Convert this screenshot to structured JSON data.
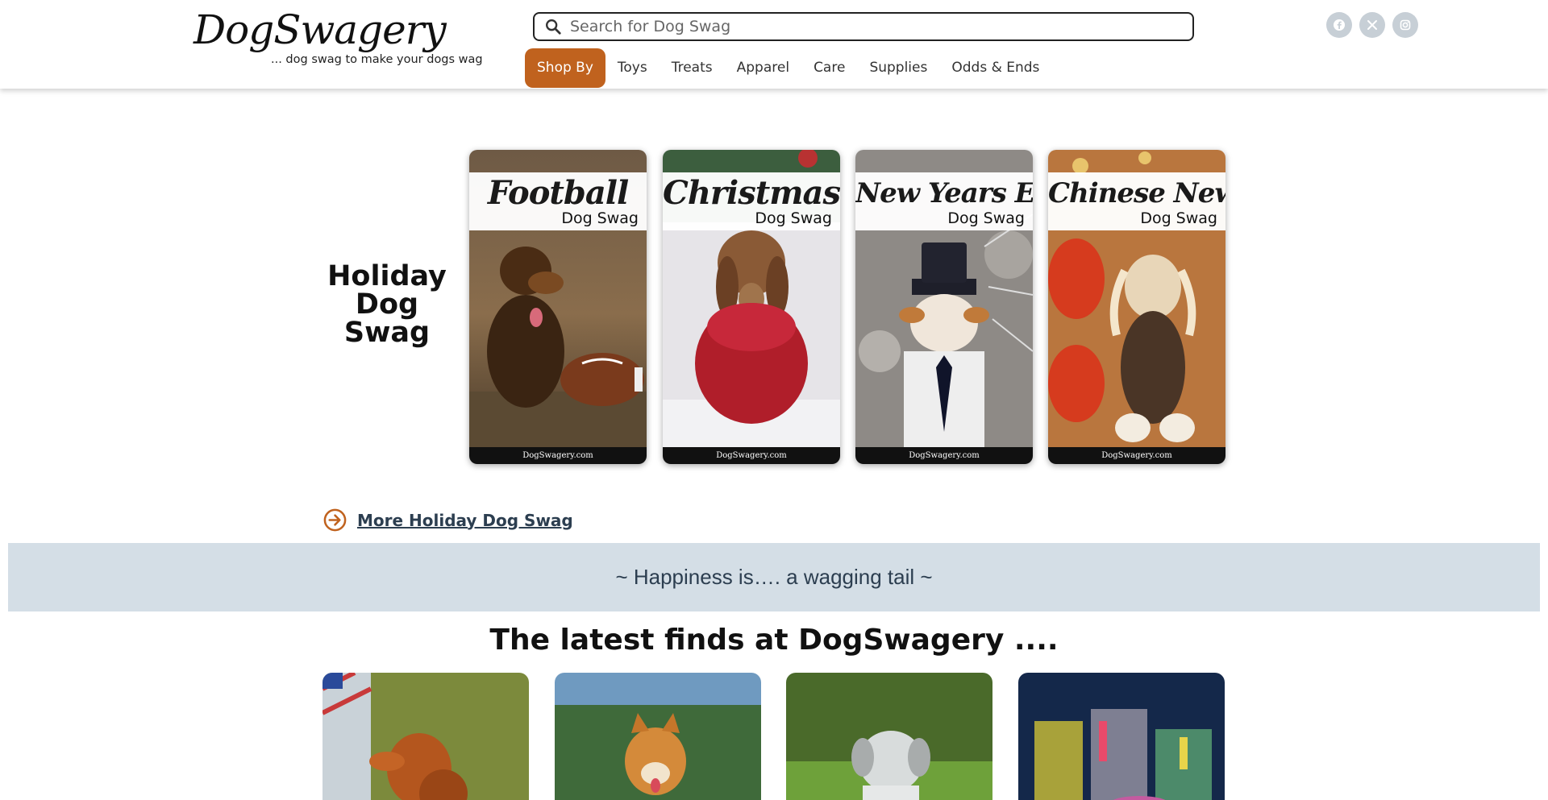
{
  "header": {
    "logo_text": "DogSwagery",
    "tagline": "... dog swag to make your dogs wag",
    "search_placeholder": "Search for Dog Swag",
    "social_icons": [
      "facebook-icon",
      "x-icon",
      "instagram-icon"
    ]
  },
  "nav": {
    "items": [
      "Shop By",
      "Toys",
      "Treats",
      "Apparel",
      "Care",
      "Supplies",
      "Odds & Ends"
    ],
    "active_index": 0
  },
  "holiday": {
    "title": "Holiday Dog Swag",
    "cards": [
      {
        "title": "Football",
        "subtitle": "Dog Swag",
        "footer": "DogSwagery.com"
      },
      {
        "title": "Christmas",
        "subtitle": "Dog Swag",
        "footer": "DogSwagery.com"
      },
      {
        "title": "New Years Eve",
        "subtitle": "Dog Swag",
        "footer": "DogSwagery.com"
      },
      {
        "title": "Chinese New Year",
        "subtitle": "Dog Swag",
        "footer": "DogSwagery.com"
      }
    ],
    "more_link": "More Holiday Dog Swag"
  },
  "banner_text": "~ Happiness is…. a wagging tail ~",
  "latest": {
    "title": "The latest finds at DogSwagery ...."
  },
  "colors": {
    "accent": "#c0621e",
    "banner_bg": "#d4dee6",
    "link": "#2c3e50"
  }
}
